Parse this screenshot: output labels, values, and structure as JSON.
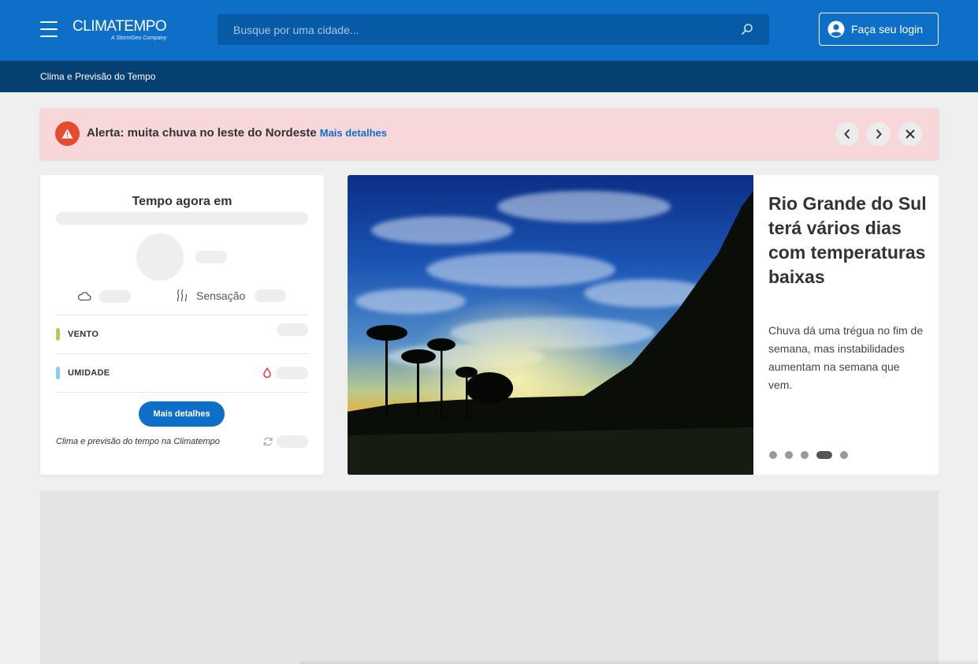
{
  "header": {
    "logo_main": "CLIMATEMPO",
    "logo_sub": "A StormGeo Company",
    "search_placeholder": "Busque por uma cidade...",
    "login_label": "Faça seu login"
  },
  "breadcrumb": "Clima e Previsão do Tempo",
  "alert": {
    "text": "Alerta: muita chuva no leste do Nordeste",
    "link": "Mais detalhes"
  },
  "weather_card": {
    "title": "Tempo agora em",
    "sensation_label": "Sensação",
    "wind_label": "VENTO",
    "humidity_label": "UMIDADE",
    "details_button": "Mais detalhes",
    "footer": "Clima e previsão do tempo na Climatempo"
  },
  "news": {
    "title": "Rio Grande do Sul terá vários dias com temperaturas baixas",
    "description": "Chuva dá uma trégua no fim de semana, mas instabilidades aumentam na semana que vem.",
    "slides": 5,
    "active_slide": 4
  },
  "colors": {
    "header_blue": "#0d6fc7",
    "breadcrumb_navy": "#054073",
    "alert_bg": "#f8d7da",
    "alert_icon": "#e54b2e",
    "wind_bar": "#b5c95a",
    "humidity_bar": "#8ecbf0"
  }
}
